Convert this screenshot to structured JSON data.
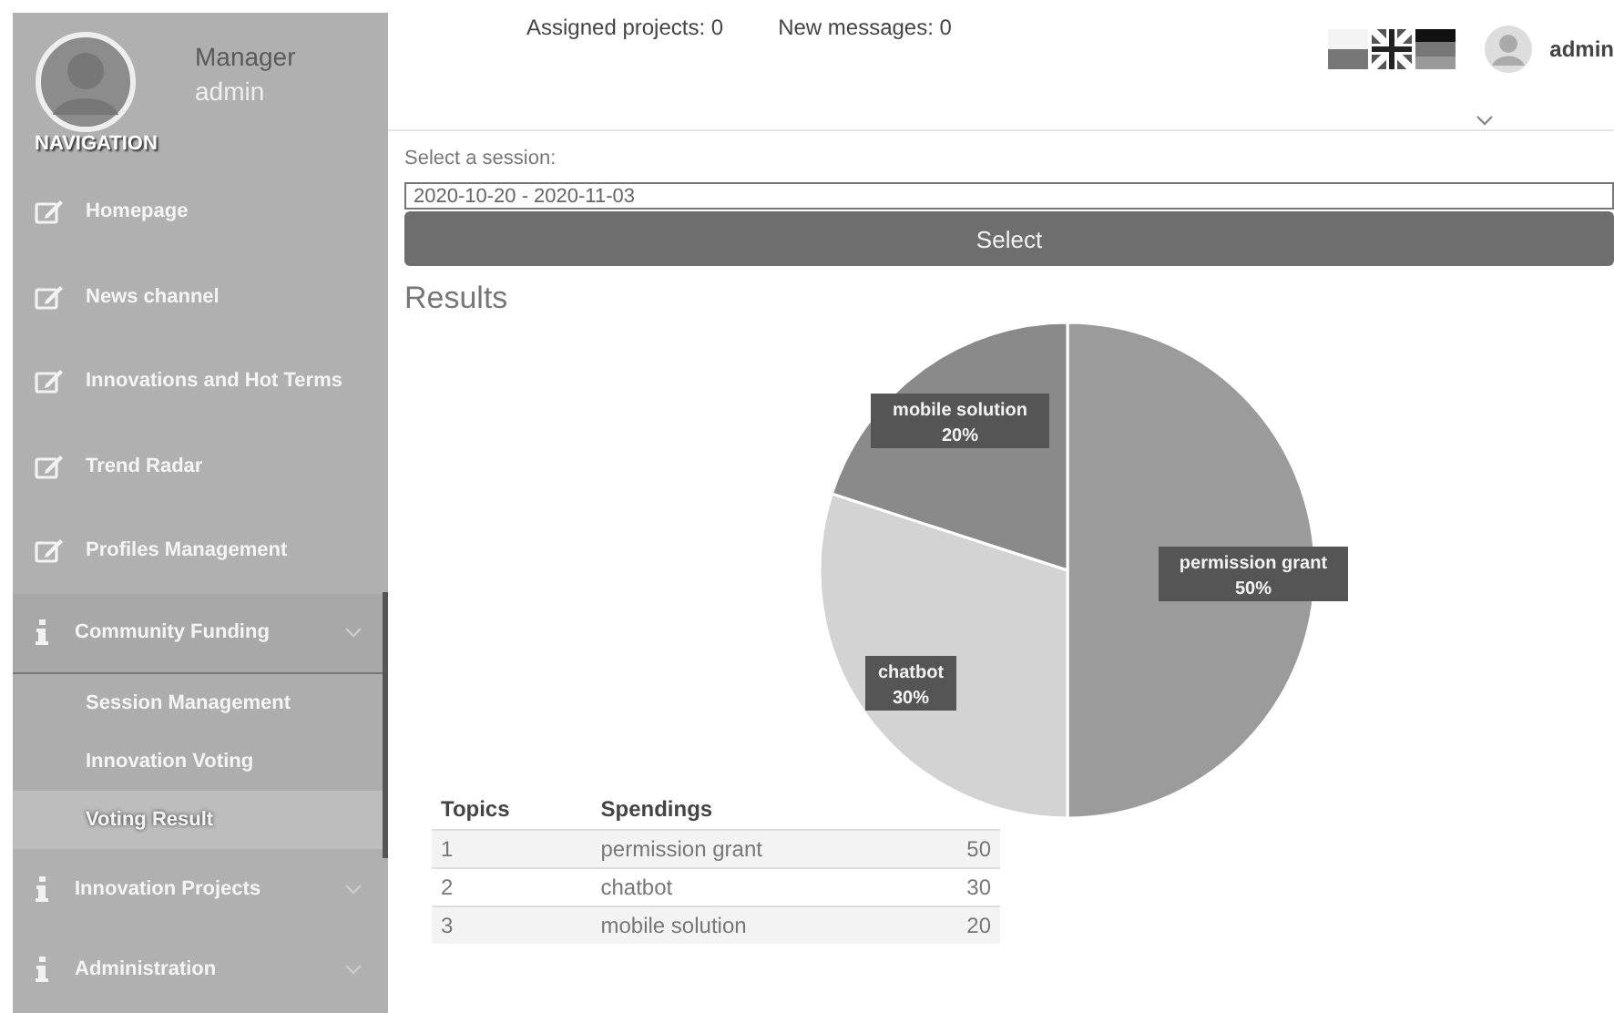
{
  "profile": {
    "role": "Manager",
    "name": "admin"
  },
  "sidebar": {
    "heading": "NAVIGATION",
    "items": [
      {
        "kind": "link",
        "label": "Homepage"
      },
      {
        "kind": "link",
        "label": "News channel"
      },
      {
        "kind": "link",
        "label": "Innovations and Hot Terms"
      },
      {
        "kind": "link",
        "label": "Trend Radar"
      },
      {
        "kind": "link",
        "label": "Profiles Management"
      },
      {
        "kind": "group",
        "label": "Community Funding",
        "expanded": true,
        "children": [
          {
            "label": "Session Management",
            "selected": false
          },
          {
            "label": "Innovation Voting",
            "selected": false
          },
          {
            "label": "Voting Result",
            "selected": true
          }
        ]
      },
      {
        "kind": "group",
        "label": "Innovation Projects",
        "expanded": false
      },
      {
        "kind": "group",
        "label": "Administration",
        "expanded": false
      }
    ]
  },
  "header": {
    "stats": [
      "Assigned projects: 0",
      "New messages: 0"
    ],
    "user": "admin"
  },
  "session": {
    "label": "Select a session:",
    "value": "2020-10-20 - 2020-11-03",
    "button": "Select"
  },
  "results": {
    "title": "Results",
    "chart_data": {
      "type": "pie",
      "categories": [
        "permission grant",
        "chatbot",
        "mobile solution"
      ],
      "values": [
        50,
        30,
        20
      ],
      "colors": [
        "#9b9b9b",
        "#d3d3d3",
        "#8a8a8a"
      ],
      "value_labels": [
        "50%",
        "30%",
        "20%"
      ]
    },
    "table": {
      "columns": [
        "Topics",
        "Spendings"
      ],
      "rows": [
        [
          "1",
          "permission grant",
          "50"
        ],
        [
          "2",
          "chatbot",
          "30"
        ],
        [
          "3",
          "mobile solution",
          "20"
        ]
      ]
    }
  }
}
